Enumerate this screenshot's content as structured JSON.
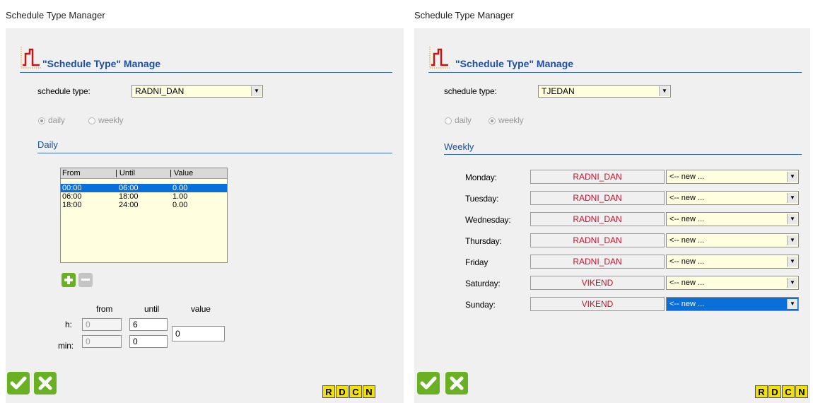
{
  "left": {
    "window_title": "Schedule Type Manager",
    "heading": "\"Schedule Type\" Manage",
    "schedule_type_label": "schedule type:",
    "schedule_type_value": "RADNI_DAN",
    "radio_daily": "daily",
    "radio_weekly": "weekly",
    "section": "Daily",
    "table": {
      "headers": [
        "From",
        "| Until",
        "| Value"
      ],
      "rows": [
        {
          "from": "00:00",
          "until": "06:00",
          "value": "0.00",
          "selected": true
        },
        {
          "from": "06:00",
          "until": "18:00",
          "value": "1.00",
          "selected": false
        },
        {
          "from": "18:00",
          "until": "24:00",
          "value": "0.00",
          "selected": false
        }
      ]
    },
    "edit": {
      "col_from": "from",
      "col_until": "until",
      "col_value": "value",
      "row_h": "h:",
      "row_min": "min:",
      "h_from": "0",
      "h_until": "6",
      "min_from": "0",
      "min_until": "0",
      "value": "0"
    },
    "rdcn": [
      "R",
      "D",
      "C",
      "N"
    ]
  },
  "right": {
    "window_title": "Schedule Type Manager",
    "heading": "\"Schedule Type\" Manage",
    "schedule_type_label": "schedule type:",
    "schedule_type_value": "TJEDAN",
    "radio_daily": "daily",
    "radio_weekly": "weekly",
    "section": "Weekly",
    "days": [
      {
        "day": "Monday:",
        "type": "RADNI_DAN",
        "combo": "<-- new ...",
        "selected": false
      },
      {
        "day": "Tuesday:",
        "type": "RADNI_DAN",
        "combo": "<-- new ...",
        "selected": false
      },
      {
        "day": "Wednesday:",
        "type": "RADNI_DAN",
        "combo": "<-- new ...",
        "selected": false
      },
      {
        "day": "Thursday:",
        "type": "RADNI_DAN",
        "combo": "<-- new ...",
        "selected": false
      },
      {
        "day": "Friday",
        "type": "RADNI_DAN",
        "combo": "<-- new ...",
        "selected": false
      },
      {
        "day": "Saturday:",
        "type": "VIKEND",
        "combo": "<-- new ...",
        "selected": false
      },
      {
        "day": "Sunday:",
        "type": "VIKEND",
        "combo": "<-- new ...",
        "selected": true
      }
    ],
    "rdcn": [
      "R",
      "D",
      "C",
      "N"
    ]
  },
  "colors": {
    "accent": "#1f4fa0",
    "green": "#6ab023",
    "selection": "#0a6fd8",
    "field_bg": "#ffffe0",
    "day_text": "#c8102e",
    "rdcn_bg": "#f2e000"
  }
}
